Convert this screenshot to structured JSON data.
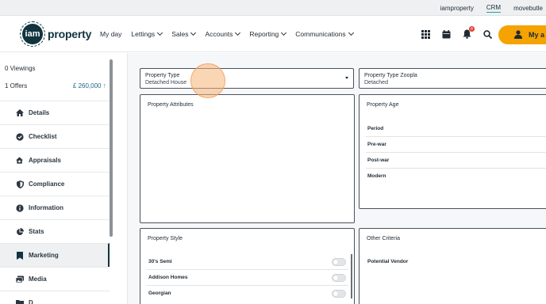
{
  "topbar": {
    "links": [
      "iamproperty",
      "CRM",
      "movebutle"
    ]
  },
  "header": {
    "logo": {
      "mark": "iam",
      "text": "property"
    },
    "nav": [
      "My day",
      "Lettings",
      "Sales",
      "Accounts",
      "Reporting",
      "Communications"
    ],
    "icons": [
      "apps-grid-icon",
      "calendar-icon",
      "bell-icon",
      "search-icon"
    ],
    "notification_count": "8",
    "account_label": "My a"
  },
  "sidebar": {
    "metrics": [
      {
        "label": "0 Viewings",
        "value": ""
      },
      {
        "label": "1 Offers",
        "value": "£ 260,000"
      }
    ],
    "items": [
      {
        "label": "Details",
        "icon": "home-icon"
      },
      {
        "label": "Checklist",
        "icon": "check-circle-icon"
      },
      {
        "label": "Appraisals",
        "icon": "house-search-icon"
      },
      {
        "label": "Compliance",
        "icon": "shield-icon"
      },
      {
        "label": "Information",
        "icon": "info-icon"
      },
      {
        "label": "Stats",
        "icon": "pie-chart-icon"
      },
      {
        "label": "Marketing",
        "icon": "bookmark-icon",
        "active": true
      },
      {
        "label": "Media",
        "icon": "images-icon"
      },
      {
        "label": "D",
        "icon": "folder-icon"
      }
    ]
  },
  "form": {
    "property_type": {
      "title": "Property Type",
      "value": "Detached House"
    },
    "property_type_zoopla": {
      "title": "Property Type Zoopla",
      "value": "Detached"
    },
    "property_attributes": {
      "title": "Property Attributes"
    },
    "property_age": {
      "title": "Property Age",
      "options": [
        "Period",
        "Pre-war",
        "Post-war",
        "Modern"
      ]
    },
    "property_style": {
      "title": "Property Style",
      "options": [
        "30's Semi",
        "Addison Homes",
        "Georgian"
      ]
    },
    "other_criteria": {
      "title": "Other Criteria",
      "options": [
        "Potential Vendor"
      ]
    }
  }
}
